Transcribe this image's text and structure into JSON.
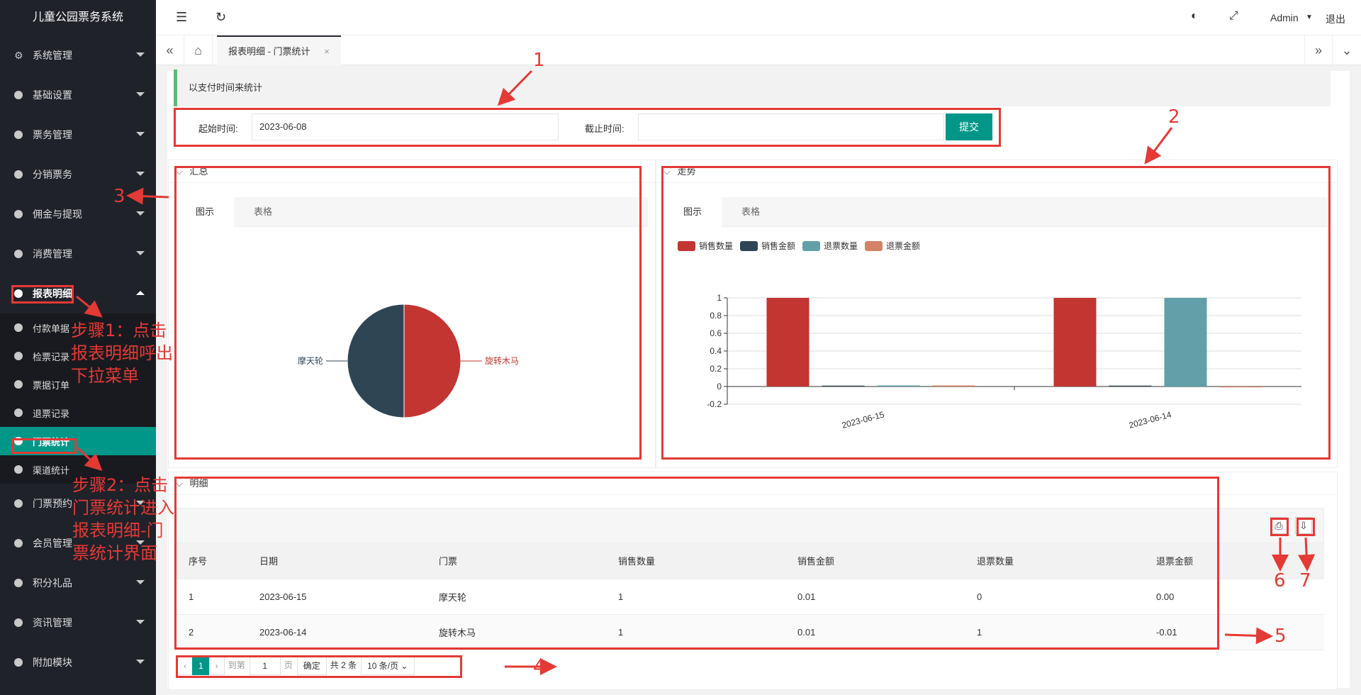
{
  "sidebar": {
    "logo": "儿童公园票务系统",
    "items": [
      {
        "label": "系统管理"
      },
      {
        "label": "基础设置"
      },
      {
        "label": "票务管理"
      },
      {
        "label": "分销票务"
      },
      {
        "label": "佣金与提现"
      },
      {
        "label": "消费管理"
      },
      {
        "label": "报表明细"
      }
    ],
    "sub_items": [
      {
        "label": "付款单据"
      },
      {
        "label": "检票记录"
      },
      {
        "label": "票据订单"
      },
      {
        "label": "退票记录"
      },
      {
        "label": "门票统计"
      },
      {
        "label": "渠道统计"
      }
    ],
    "items_after": [
      {
        "label": "门票预约"
      },
      {
        "label": "会员管理"
      },
      {
        "label": "积分礼品"
      },
      {
        "label": "资讯管理"
      },
      {
        "label": "附加模块"
      }
    ]
  },
  "header": {
    "admin_label": "Admin",
    "logout_label": "退出"
  },
  "tabs": {
    "active_tab": "报表明细 - 门票统计",
    "close": "×"
  },
  "hint": "以支付时间来统计",
  "filter": {
    "start_label": "起始时间:",
    "start_value": "2023-06-08",
    "end_label": "截止时间:",
    "end_value": "",
    "submit_label": "提交"
  },
  "summary_panel": {
    "title": "汇总",
    "tab_chart": "图示",
    "tab_table": "表格",
    "pie_labels": [
      "摩天轮",
      "旋转木马"
    ]
  },
  "trend_panel": {
    "title": "走势",
    "tab_chart": "图示",
    "tab_table": "表格",
    "legend": [
      "销售数量",
      "销售金额",
      "退票数量",
      "退票金额"
    ]
  },
  "chart_data": [
    {
      "type": "pie",
      "categories": [
        "摩天轮",
        "旋转木马"
      ],
      "values": [
        1,
        1
      ],
      "colors": [
        "#2f4554",
        "#c23531"
      ]
    },
    {
      "type": "bar",
      "categories": [
        "2023-06-15",
        "2023-06-14"
      ],
      "series": [
        {
          "name": "销售数量",
          "values": [
            1,
            1
          ],
          "color": "#c23531"
        },
        {
          "name": "销售金额",
          "values": [
            0.01,
            0.01
          ],
          "color": "#2f4554"
        },
        {
          "name": "退票数量",
          "values": [
            0,
            1
          ],
          "color": "#61a0a8"
        },
        {
          "name": "退票金额",
          "values": [
            0,
            -0.01
          ],
          "color": "#d48265"
        }
      ],
      "yticks": [
        "1",
        "0.8",
        "0.6",
        "0.4",
        "0.2",
        "0",
        "-0.2"
      ],
      "ylim": [
        -0.2,
        1
      ]
    }
  ],
  "detail_panel": {
    "title": "明细",
    "columns": [
      "序号",
      "日期",
      "门票",
      "销售数量",
      "销售金额",
      "退票数量",
      "退票金额"
    ],
    "rows": [
      [
        "1",
        "2023-06-15",
        "摩天轮",
        "1",
        "0.01",
        "0",
        "0.00"
      ],
      [
        "2",
        "2023-06-14",
        "旋转木马",
        "1",
        "0.01",
        "1",
        "-0.01"
      ]
    ]
  },
  "pager": {
    "prev": "‹",
    "current": "1",
    "next": "›",
    "goto_label": "到第",
    "goto_value": "1",
    "page_label": "页",
    "confirm_label": "确定",
    "total_label": "共 2 条",
    "size_label": "10 条/页"
  },
  "annotations": {
    "n1": "1",
    "n2": "2",
    "n3": "3",
    "n4": "4",
    "n5": "5",
    "n6": "6",
    "n7": "7",
    "step1": "步骤1：点击报表明细呼出下拉菜单",
    "step2": "步骤2：点击门票统计进入报表明细-门票统计界面"
  }
}
